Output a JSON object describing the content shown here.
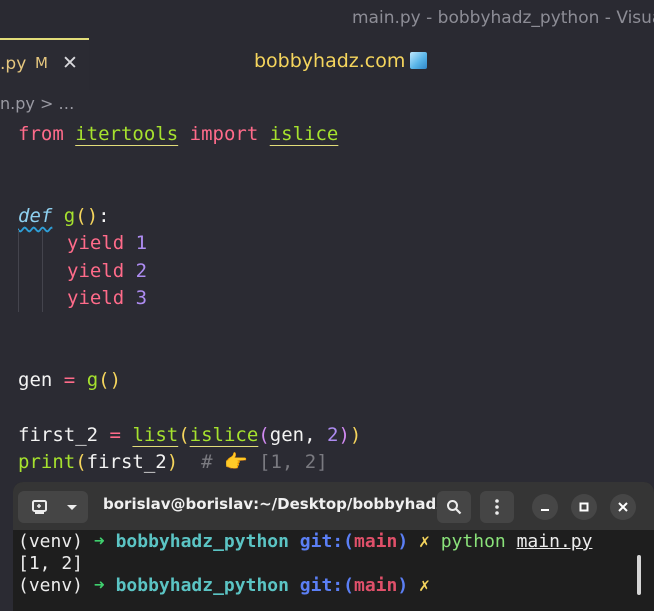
{
  "window": {
    "title": "main.py - bobbyhadz_python - Visua"
  },
  "tab": {
    "name": ".py",
    "modified": "M",
    "close": "✕"
  },
  "center_title": "bobbyhadz.com",
  "breadcrumb": "n.py > …",
  "code": {
    "l1": {
      "kw1": "from",
      "mod": "itertools",
      "kw2": "import",
      "name": "islice"
    },
    "l2": {
      "kw": "def",
      "fn": "g",
      "open": "(",
      "close": ")",
      "colon": ":"
    },
    "yields": [
      {
        "kw": "yield",
        "num": "1"
      },
      {
        "kw": "yield",
        "num": "2"
      },
      {
        "kw": "yield",
        "num": "3"
      }
    ],
    "gen": {
      "var": "gen",
      "eq": "=",
      "fn": "g",
      "open": "(",
      "close": ")"
    },
    "first": {
      "var": "first_2",
      "eq": "=",
      "list": "list",
      "islice": "islice",
      "arg": "gen",
      "comma": ",",
      "num": "2"
    },
    "print": {
      "fn": "print",
      "arg": "first_2",
      "comment": "# 👉 [1, 2]"
    }
  },
  "terminal": {
    "title": "borislav@borislav:~/Desktop/bobbyhadz_...",
    "lines": [
      {
        "env": "(venv)",
        "arrow": "➜",
        "dir": "bobbyhadz_python",
        "git": "git:(",
        "branch": "main",
        "git_close": ")",
        "x": "✗",
        "cmd": "python",
        "arg": "main.py"
      },
      {
        "output": "[1, 2]"
      },
      {
        "env": "(venv)",
        "arrow": "➜",
        "dir": "bobbyhadz_python",
        "git": "git:(",
        "branch": "main",
        "git_close": ")",
        "x": "✗"
      }
    ]
  }
}
